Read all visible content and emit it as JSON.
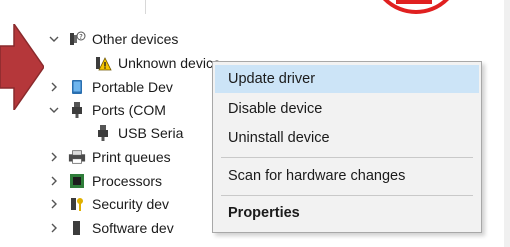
{
  "tree": {
    "items": [
      {
        "label": "Other devices",
        "expanded": true,
        "icon": "other-devices-icon"
      },
      {
        "label": "Unknown device",
        "icon": "unknown-device-warning-icon"
      },
      {
        "label": "Portable Dev",
        "icon": "portable-device-icon"
      },
      {
        "label": "Ports (COM",
        "icon": "port-icon"
      },
      {
        "label": "USB Seria",
        "icon": "usb-serial-icon"
      },
      {
        "label": "Print queues",
        "icon": "printer-icon"
      },
      {
        "label": "Processors",
        "icon": "processor-icon"
      },
      {
        "label": "Security dev",
        "icon": "security-device-icon"
      },
      {
        "label": "Software dev",
        "icon": "software-device-icon"
      }
    ]
  },
  "context_menu": {
    "items": [
      {
        "label": "Update driver",
        "highlighted": true
      },
      {
        "label": "Disable device"
      },
      {
        "label": "Uninstall device"
      },
      {
        "label": "Scan for hardware changes"
      },
      {
        "label": "Properties",
        "bold": true
      }
    ]
  },
  "colors": {
    "menu_highlight": "#cce4f7",
    "annotation_red": "#e02020",
    "arrow_fill": "#b5373a"
  }
}
